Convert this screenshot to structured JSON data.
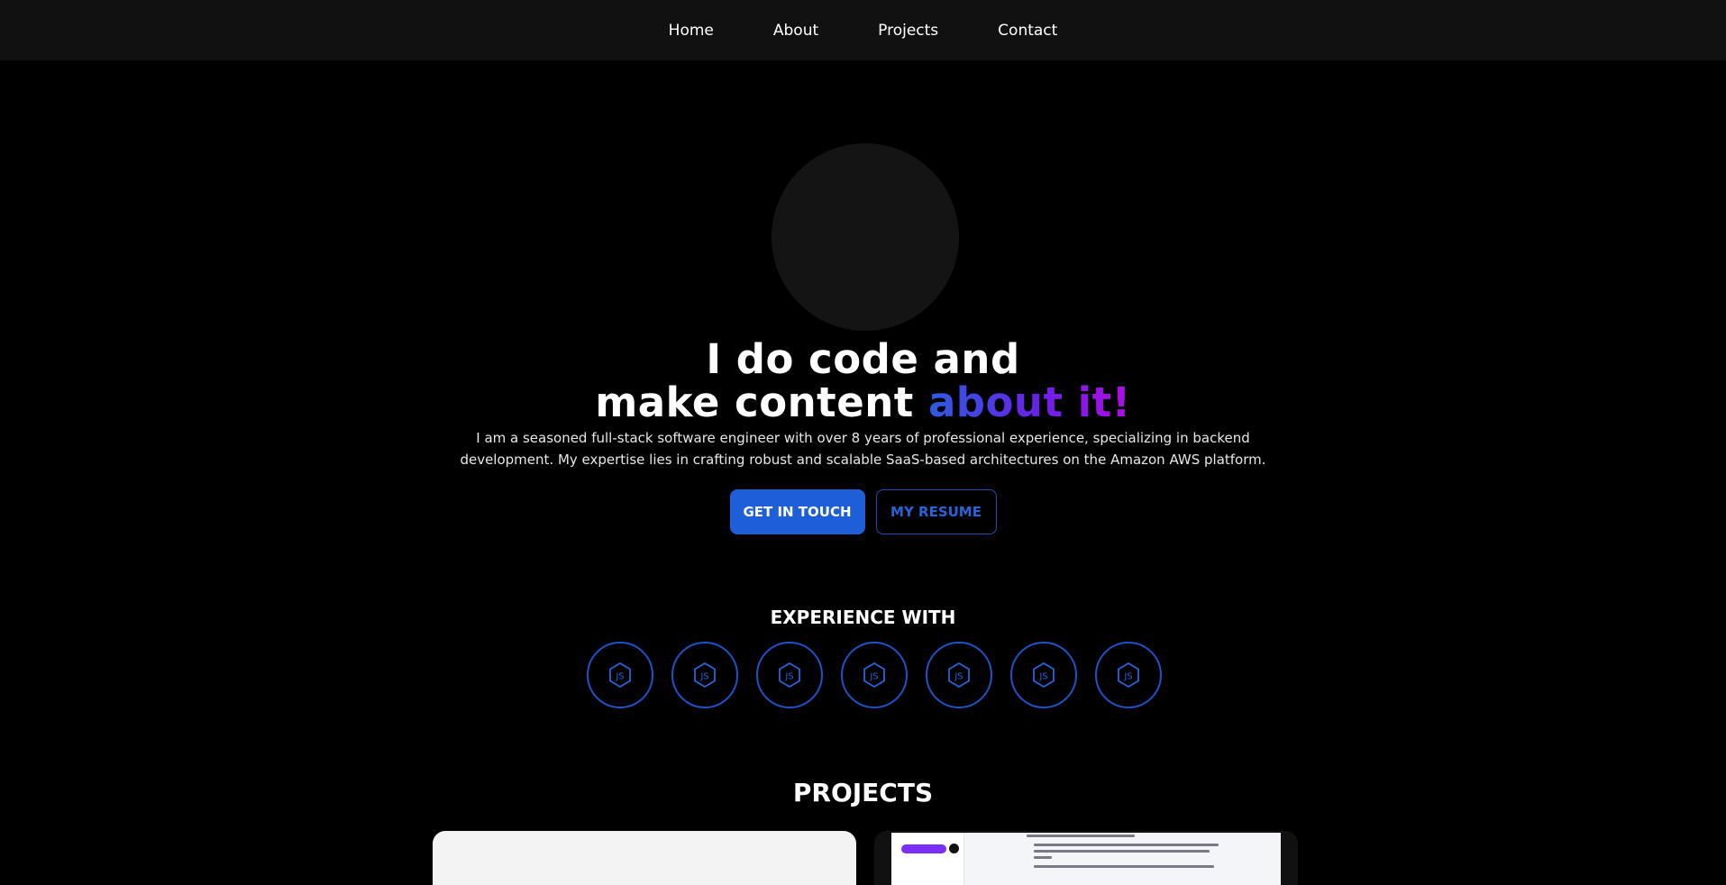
{
  "nav": {
    "items": [
      "Home",
      "About",
      "Projects",
      "Contact"
    ]
  },
  "hero": {
    "headline_line1": "I do code and",
    "headline_line2_plain": "make content ",
    "headline_line2_highlight": "about it!",
    "intro": "I am a seasoned full-stack software engineer with over 8 years of professional experience, specializing in backend development. My expertise lies in crafting robust and scalable SaaS-based architectures on the Amazon AWS platform.",
    "primary_button": "GET IN TOUCH",
    "secondary_button": "MY RESUME"
  },
  "experience": {
    "title": "EXPERIENCE WITH",
    "technologies": [
      {
        "icon": "js-icon"
      },
      {
        "icon": "js-icon"
      },
      {
        "icon": "js-icon"
      },
      {
        "icon": "js-icon"
      },
      {
        "icon": "js-icon"
      },
      {
        "icon": "js-icon"
      },
      {
        "icon": "js-icon"
      }
    ]
  },
  "projects": {
    "title": "PROJECTS"
  },
  "colors": {
    "background": "#000000",
    "navbar": "#111111",
    "accent_blue": "#1e5ed8",
    "gradient_start": "#2c5ce0",
    "gradient_end": "#b20be6"
  }
}
